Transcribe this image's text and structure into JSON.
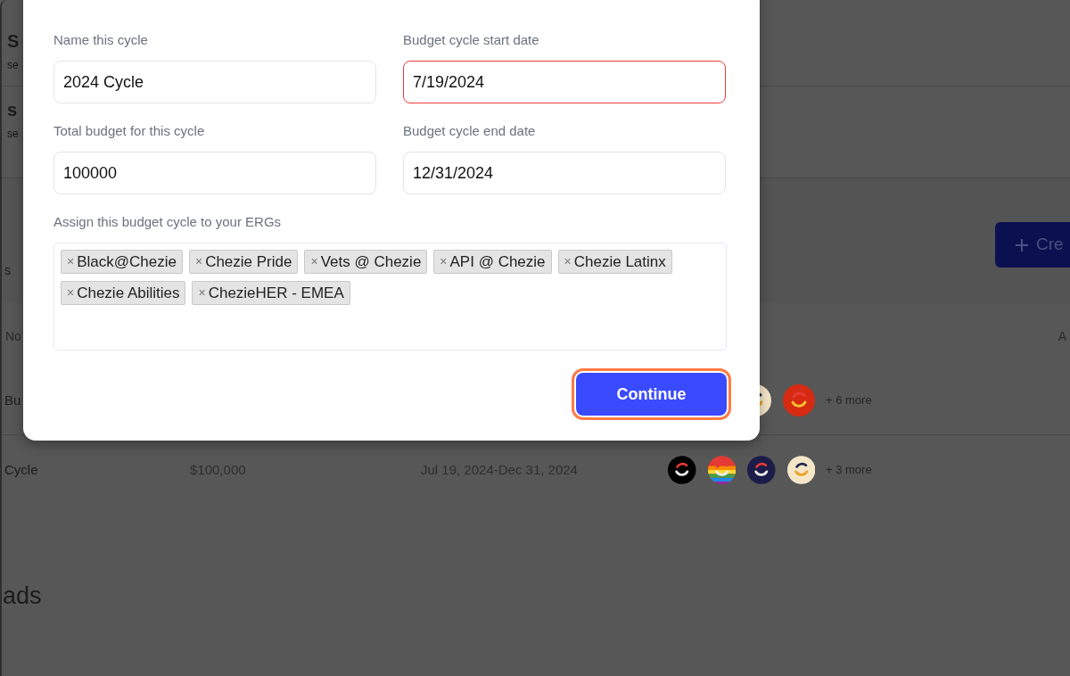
{
  "background": {
    "list_items": [
      {
        "title": "S",
        "subtitle": "se"
      },
      {
        "title": "s",
        "subtitle": "se"
      }
    ],
    "side_text": "s",
    "create_button": "Cre",
    "table": {
      "header_left": "No",
      "header_right": "A",
      "rows": [
        {
          "column_1": "Bu",
          "avatars": [
            {
              "kind": "plain",
              "color": "#f5e6c8"
            },
            {
              "kind": "plain",
              "color": "#d62a12"
            }
          ],
          "more": "+ 6 more"
        },
        {
          "column_1": "Cycle",
          "column_2": "$100,000",
          "column_3": "Jul 19, 2024-Dec 31, 2024",
          "avatars": [
            {
              "kind": "plain",
              "color": "#000000"
            },
            {
              "kind": "rainbow",
              "color": "#e53935"
            },
            {
              "kind": "plain",
              "color": "#1c1c4a"
            },
            {
              "kind": "plain",
              "color": "#f5e6c8"
            }
          ],
          "more": "+ 3 more"
        }
      ]
    },
    "section_heading": "ads"
  },
  "modal": {
    "fields": [
      {
        "label": "Name this cycle",
        "value": "2024 Cycle",
        "error": false
      },
      {
        "label": "Budget cycle start date",
        "value": "7/19/2024",
        "error": true
      },
      {
        "label": "Total budget for this cycle",
        "value": "100000",
        "error": false
      },
      {
        "label": "Budget cycle end date",
        "value": "12/31/2024",
        "error": false
      }
    ],
    "erg_label": "Assign this budget cycle to your ERGs",
    "erg_tags": [
      {
        "remove": "×",
        "label": "Black@Chezie"
      },
      {
        "remove": "×",
        "label": "Chezie Pride"
      },
      {
        "remove": "×",
        "label": "Vets @ Chezie"
      },
      {
        "remove": "×",
        "label": "API @ Chezie"
      },
      {
        "remove": "×",
        "label": "Chezie Latinx"
      },
      {
        "remove": "×",
        "label": "Chezie Abilities"
      },
      {
        "remove": "×",
        "label": "ChezieHER - EMEA"
      }
    ],
    "continue_button": "Continue"
  }
}
